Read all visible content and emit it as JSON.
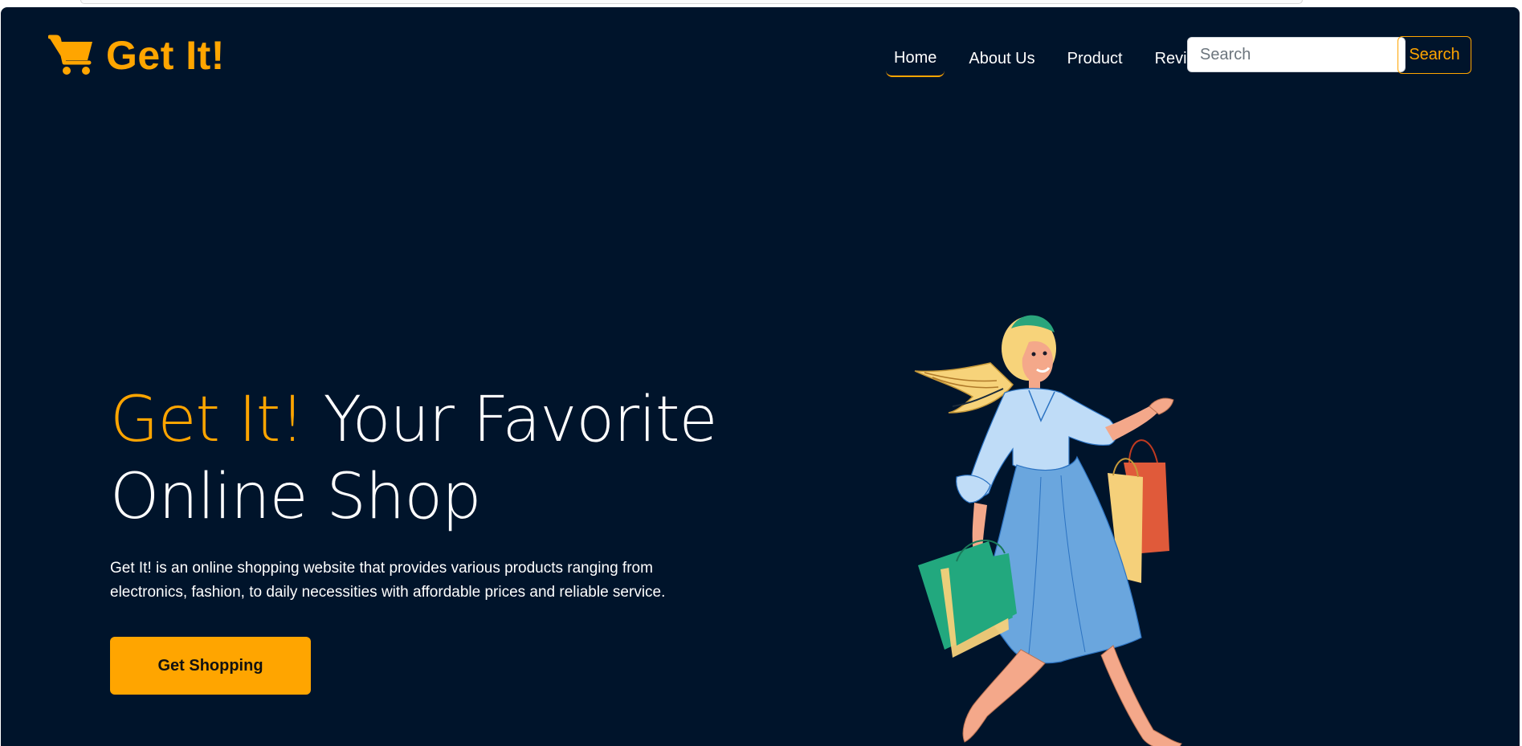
{
  "header": {
    "brand_name": "Get It!",
    "brand_icon": "shopping-cart-icon",
    "nav": [
      {
        "label": "Home",
        "active": true
      },
      {
        "label": "About Us",
        "active": false
      },
      {
        "label": "Product",
        "active": false
      },
      {
        "label": "Review",
        "active": false
      }
    ],
    "search": {
      "placeholder": "Search",
      "value": "",
      "button_label": "Search"
    }
  },
  "hero": {
    "title_accent": "Get It!",
    "title_rest": " Your Favorite Online Shop",
    "description": "Get It! is an online shopping website that provides various products ranging from electronics, fashion, to daily necessities with affordable prices and reliable service.",
    "cta_label": "Get Shopping",
    "illustration": "woman-with-shopping-bags-illustration"
  },
  "colors": {
    "background": "#00142b",
    "accent": "#ffa500",
    "text": "#ffffff"
  }
}
